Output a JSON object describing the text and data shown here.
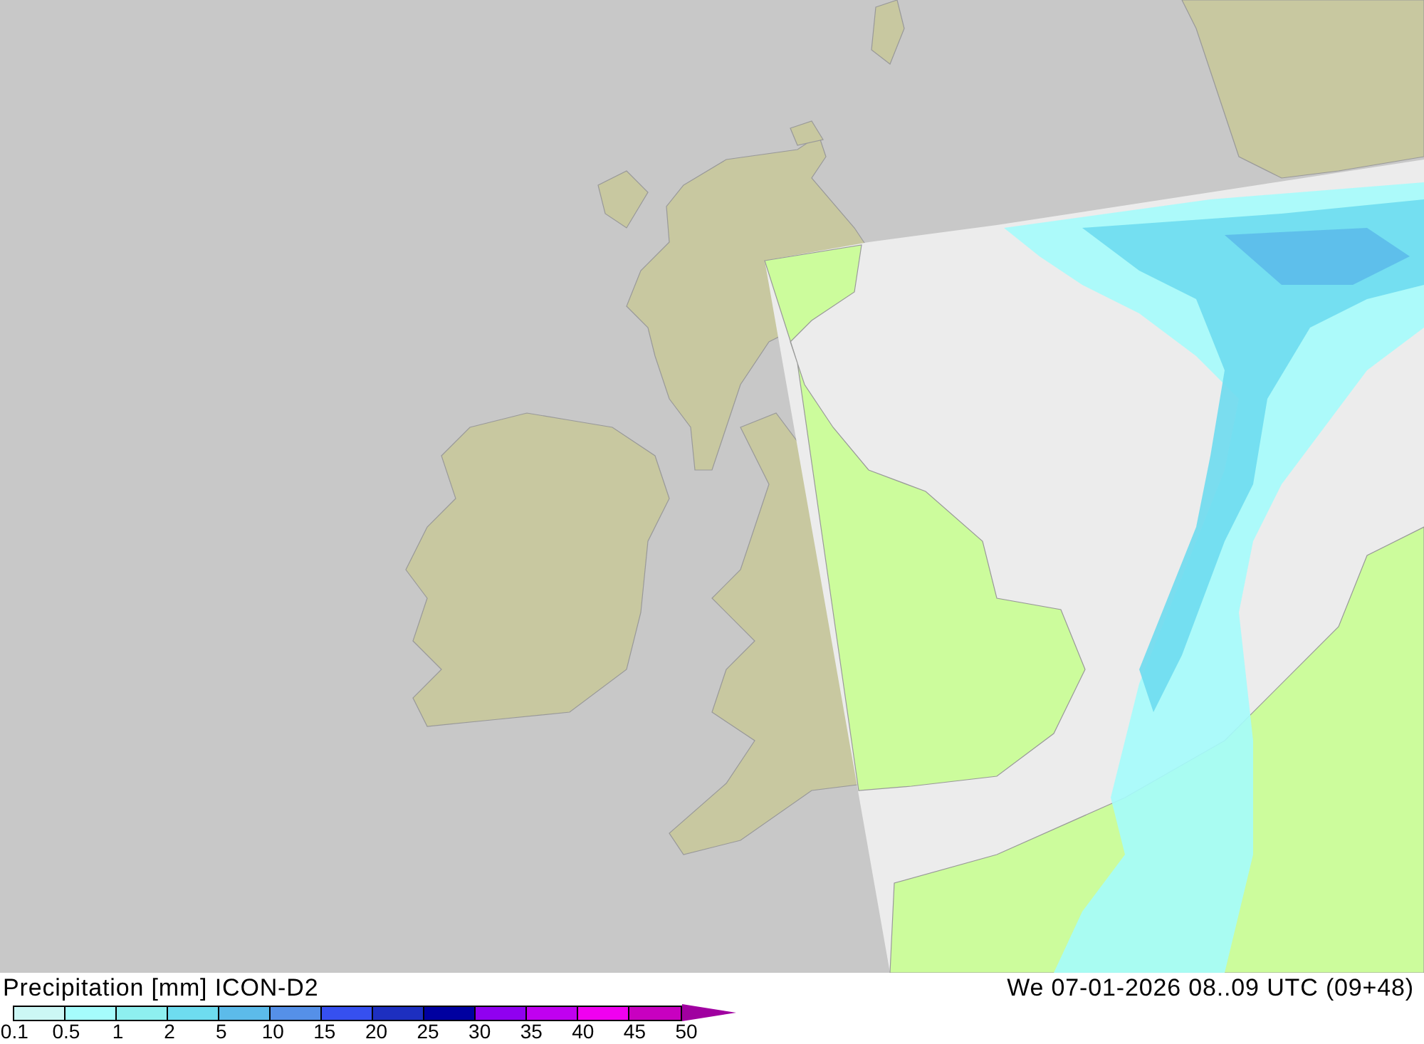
{
  "title": "Precipitation [mm] ICON-D2",
  "valid_time": "We 07-01-2026 08..09 UTC (09+48)",
  "legend": {
    "segments": [
      {
        "color": "#ccf7f5"
      },
      {
        "color": "#a5fcfc"
      },
      {
        "color": "#8eefef"
      },
      {
        "color": "#6edcef"
      },
      {
        "color": "#5cbbea"
      },
      {
        "color": "#5590e8"
      },
      {
        "color": "#3650ef"
      },
      {
        "color": "#1d2fc0"
      },
      {
        "color": "#0000a0"
      },
      {
        "color": "#9000f0"
      },
      {
        "color": "#c000f0"
      },
      {
        "color": "#f000f0"
      },
      {
        "color": "#c800c0"
      },
      {
        "color": "#a000a0",
        "kind": "overflow"
      }
    ],
    "labels": [
      "0.1",
      "0.5",
      "1",
      "2",
      "5",
      "10",
      "15",
      "20",
      "25",
      "30",
      "35",
      "40",
      "45",
      "50"
    ]
  }
}
